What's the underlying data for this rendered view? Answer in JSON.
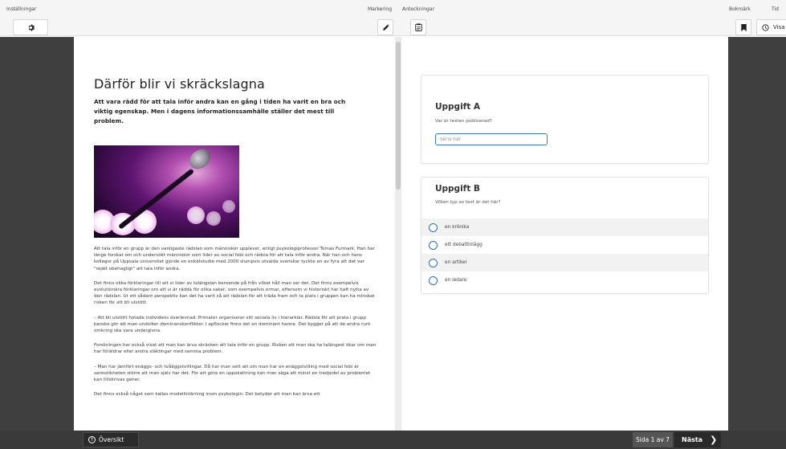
{
  "toolbar": {
    "settings_label": "Inställningar",
    "marking_label": "Markering",
    "notes_label": "Anteckningar",
    "bookmark_label": "Bokmärk",
    "time_label": "Tid",
    "time_button": "Visa"
  },
  "article": {
    "title": "Därför blir vi skräckslagna",
    "lead": "Att vara rädd för att tala inför andra kan en gång i tiden ha varit en bra och viktig egenskap. Men i dagens informationssamhälle ställer det mest till problem.",
    "paragraphs": [
      "Att tala inför en grupp är den vanligaste rädslan som människor upplever, enligt psykologiprofessor Tomas Furmark. Han har länge forskat om och undersökt människor som lider av social fobi och rädsla för att tala inför andra. När han och hans kollegor på Uppsala universitet gjorde en enkätstudie med 2000 slumpvis utvalda svenskar tyckte en av fyra att det var \"rejält obehagligt\" att tala inför andra.",
      "Det finns olika förklaringar till att vi lider av talängslan beroende på från vilket håll man ser det. Det finns exempelvis evolutionära förklaringar om att vi är rädda för olika saker, som exempelvis ormar, eftersom vi historiskt har haft nytta av den rädslan. Ur ett sådant perspektiv kan det ha varit så att rädslan för att träda fram och ta plats i gruppen kan ha minskat risken för att bli utstött.",
      "– Att bli utstött hotade individens överlevnad. Primater organiserar sitt sociala liv i hierarkier. Rädsla för att prata i grupp kanske gör att man undviker dominanskonflikter. I apflockar finns det en dominant hanne. Det bygger på att de andra runt omkring ska vara undergivna.",
      "Forskningen har också visat att man kan ärva skräcken att tala inför en grupp. Risken att man ska ha talängest ökar om man har föräldrar eller andra släktingar med samma problem.",
      "– Man har jämfört enäggs- och tvåäggstvillingar. Då har man sett att om man har en enäggstvilling med social fobi är sannolikheten större att man själv har det. För att göra en uppskattning kan man säga att minst en tredjedel av problemet kan tillskrivas gener.",
      "Det finns också något som kallas modellinlärning inom psykologin. Det betyder att man kan ärva ett"
    ]
  },
  "task_a": {
    "title": "Uppgift A",
    "question": "Var är texten publicerad?",
    "placeholder": "Skriv här"
  },
  "task_b": {
    "title": "Uppgift B",
    "question": "Vilken typ av text är det här?",
    "options": [
      "en krönika",
      "ett debattinlägg",
      "en artikel",
      "en ledare"
    ]
  },
  "footer": {
    "overview_label": "Översikt",
    "page_indicator": "Sida 1 av 7",
    "next_label": "Nästa"
  },
  "colors": {
    "accent": "#2f6fa8",
    "dark_panel": "#3f3f3f",
    "bottom_bar": "#3a3a3a"
  },
  "icons": [
    "gear-icon",
    "pen-icon",
    "notes-icon",
    "bookmark-icon",
    "clock-icon",
    "arrow-up-circle-icon",
    "chevron-right-icon"
  ]
}
